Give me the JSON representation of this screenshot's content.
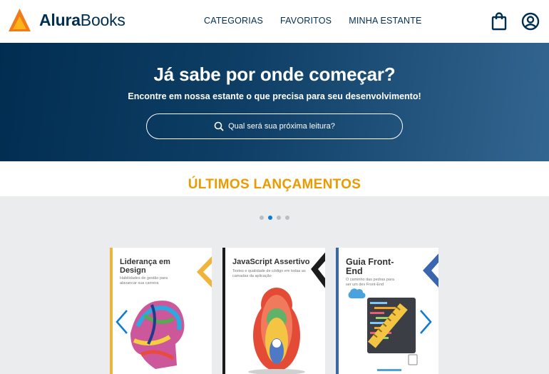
{
  "header": {
    "logo_bold": "Alura",
    "logo_light": "Books",
    "nav": [
      "CATEGORIAS",
      "FAVORITOS",
      "MINHA ESTANTE"
    ],
    "icons": [
      "bag-icon",
      "user-icon"
    ]
  },
  "hero": {
    "title": "Já sabe por onde começar?",
    "subtitle": "Encontre em nossa estante o que precisa para seu desenvolvimento!",
    "search_placeholder": "Qual será sua próxima leitura?"
  },
  "section": {
    "title": "ÚLTIMOS LANÇAMENTOS"
  },
  "carousel": {
    "dots": 4,
    "active_dot": 1,
    "books": [
      {
        "title": "Liderança em Design",
        "subtitle": "Habilidades de gestão para alavancar sua carreira"
      },
      {
        "title": "JavaScript Assertivo",
        "subtitle": "Testes e qualidade de código em todas as camadas da aplicação"
      },
      {
        "title": "Guia Front-End",
        "subtitle": "O caminho das pedras para ser um dev Front-End"
      }
    ]
  },
  "colors": {
    "navy": "#002f52",
    "orange": "#eb9b00",
    "accent_blue": "#0b7bd4"
  }
}
